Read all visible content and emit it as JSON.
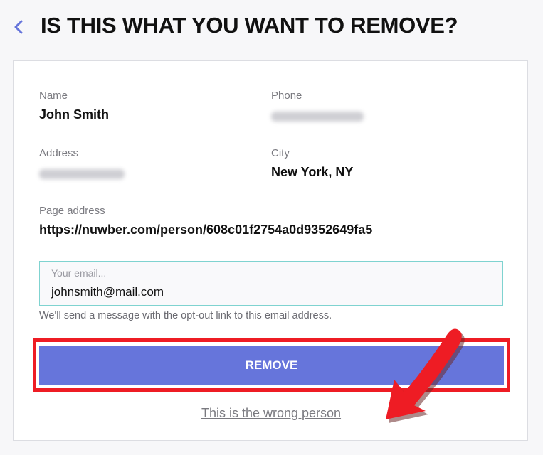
{
  "header": {
    "title": "IS THIS WHAT YOU WANT TO REMOVE?",
    "back_icon": "chevron-left-icon"
  },
  "record": {
    "name_label": "Name",
    "name_value": "John Smith",
    "phone_label": "Phone",
    "address_label": "Address",
    "city_label": "City",
    "city_value": "New York, NY",
    "page_label": "Page address",
    "page_value": "https://nuwber.com/person/608c01f2754a0d9352649fa5"
  },
  "form": {
    "email_placeholder": "Your email...",
    "email_value": "johnsmith@mail.com",
    "hint": "We'll send a message with the opt-out link to this email address.",
    "remove_label": "REMOVE",
    "wrong_person_label": "This is the wrong person"
  },
  "colors": {
    "accent": "#6675db",
    "highlight": "#ee1c24",
    "input_border": "#7fd3d0"
  }
}
